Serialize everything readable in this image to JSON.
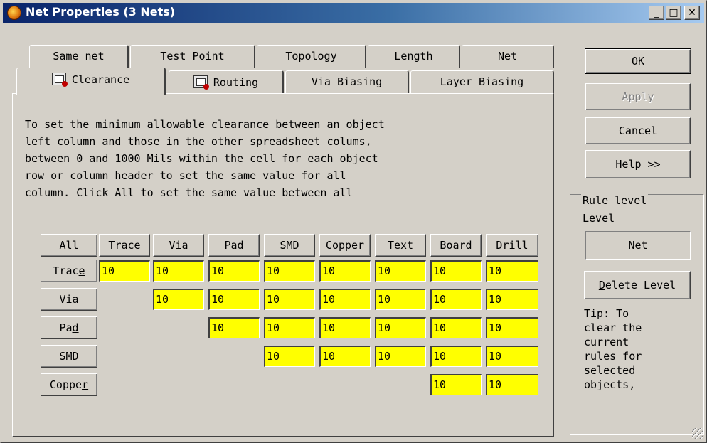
{
  "window": {
    "title": "Net Properties (3 Nets)",
    "min": "_",
    "max": "□",
    "close": "✕"
  },
  "tabs": {
    "row1": [
      "Same net",
      "Test Point",
      "Topology",
      "Length",
      "Net"
    ],
    "row2": [
      "Clearance",
      "Routing",
      "Via Biasing",
      "Layer Biasing"
    ]
  },
  "description": [
    "To set the minimum allowable clearance between an object",
    "left column and those in the other spreadsheet colums,",
    "between 0 and 1000 Mils within the cell for each object",
    "row or column header to set the same value for all",
    "column. Click All to set the same value between all"
  ],
  "grid": {
    "all_pre": "A",
    "all_ul": "l",
    "all_post": "l",
    "columns": [
      {
        "pre": "Tra",
        "ul": "c",
        "post": "e"
      },
      {
        "pre": "",
        "ul": "V",
        "post": "ia"
      },
      {
        "pre": "",
        "ul": "P",
        "post": "ad"
      },
      {
        "pre": "S",
        "ul": "M",
        "post": "D"
      },
      {
        "pre": "",
        "ul": "C",
        "post": "opper"
      },
      {
        "pre": "Te",
        "ul": "x",
        "post": "t"
      },
      {
        "pre": "",
        "ul": "B",
        "post": "oard"
      },
      {
        "pre": "D",
        "ul": "r",
        "post": "ill"
      }
    ],
    "rows": [
      {
        "pre": "Trac",
        "ul": "e",
        "post": ""
      },
      {
        "pre": "V",
        "ul": "i",
        "post": "a"
      },
      {
        "pre": "Pa",
        "ul": "d",
        "post": ""
      },
      {
        "pre": "S",
        "ul": "M",
        "post": "D"
      },
      {
        "pre": "Coppe",
        "ul": "r",
        "post": ""
      }
    ],
    "values": [
      [
        "10",
        "10",
        "10",
        "10",
        "10",
        "10",
        "10",
        "10"
      ],
      [
        "10",
        "10",
        "10",
        "10",
        "10",
        "10",
        "10"
      ],
      [
        "10",
        "10",
        "10",
        "10",
        "10",
        "10"
      ],
      [
        "10",
        "10",
        "10",
        "10",
        "10"
      ],
      [
        "10",
        "10"
      ]
    ]
  },
  "buttons": {
    "ok": "OK",
    "apply": "Apply",
    "cancel": "Cancel",
    "help": "Help >>"
  },
  "rule_level": {
    "group_label": "Rule level",
    "level_label": "Level",
    "level_value": "Net",
    "delete_pre": "",
    "delete_ul": "D",
    "delete_post": "elete Level",
    "tip": "Tip: To\nclear the\ncurrent\nrules for\nselected\nobjects,"
  },
  "colors": {
    "cell": "#ffff00",
    "titlebar_start": "#0a246a",
    "titlebar_end": "#a6caf0",
    "face": "#d4d0c8"
  }
}
